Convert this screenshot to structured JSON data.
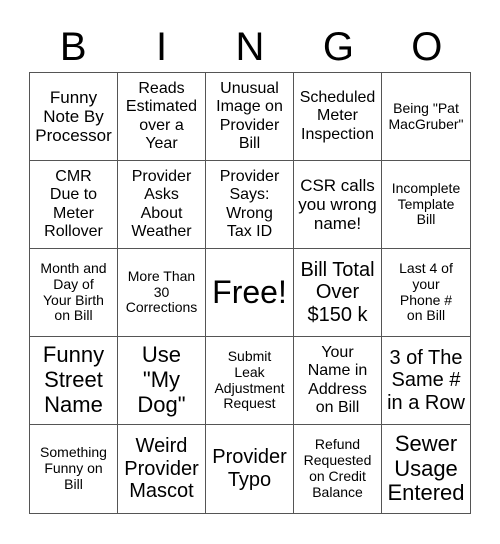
{
  "title_letters": [
    "B",
    "I",
    "N",
    "G",
    "O"
  ],
  "cells": [
    {
      "text": "Funny\nNote By\nProcessor",
      "size": "l"
    },
    {
      "text": "Reads\nEstimated\nover a\nYear",
      "size": "m"
    },
    {
      "text": "Unusual\nImage on\nProvider\nBill",
      "size": "m"
    },
    {
      "text": "Scheduled\nMeter\nInspection",
      "size": "m"
    },
    {
      "text": "Being \"Pat\nMacGruber\"",
      "size": "s"
    },
    {
      "text": "CMR\nDue to\nMeter\nRollover",
      "size": "m"
    },
    {
      "text": "Provider\nAsks\nAbout\nWeather",
      "size": "m"
    },
    {
      "text": "Provider\nSays:\nWrong\nTax ID",
      "size": "m"
    },
    {
      "text": "CSR calls\nyou wrong\nname!",
      "size": "l"
    },
    {
      "text": "Incomplete\nTemplate\nBill",
      "size": "s"
    },
    {
      "text": "Month and\nDay of\nYour Birth\non Bill",
      "size": "s"
    },
    {
      "text": "More Than\n30\nCorrections",
      "size": "s"
    },
    {
      "text": "Free!",
      "size": "free"
    },
    {
      "text": "Bill Total\nOver\n$150 k",
      "size": "xl"
    },
    {
      "text": "Last 4 of\nyour\nPhone #\non Bill",
      "size": "s"
    },
    {
      "text": "Funny\nStreet\nName",
      "size": "xxl"
    },
    {
      "text": "Use\n\"My\nDog\"",
      "size": "xxl"
    },
    {
      "text": "Submit\nLeak\nAdjustment\nRequest",
      "size": "s"
    },
    {
      "text": "Your\nName in\nAddress\non Bill",
      "size": "m"
    },
    {
      "text": "3 of The\nSame #\nin a Row",
      "size": "xl"
    },
    {
      "text": "Something\nFunny on\nBill",
      "size": "s"
    },
    {
      "text": "Weird\nProvider\nMascot",
      "size": "xl"
    },
    {
      "text": "Provider\nTypo",
      "size": "xl"
    },
    {
      "text": "Refund\nRequested\non Credit\nBalance",
      "size": "s"
    },
    {
      "text": "Sewer\nUsage\nEntered",
      "size": "xxl"
    }
  ]
}
